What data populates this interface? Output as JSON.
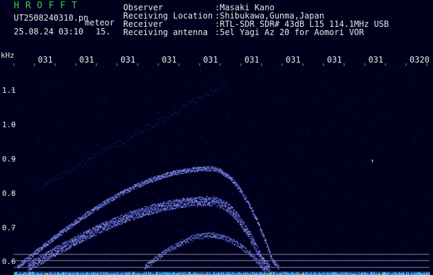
{
  "header": {
    "logo": "HROFFT",
    "filename": "UT2508240310.pn",
    "datetime": "25.08.24 03:10",
    "detection_type": "meteor",
    "count": "15.",
    "fields": [
      {
        "label": "Observer",
        "value": ":Masaki Kano"
      },
      {
        "label": "Receiving Location",
        "value": ":Shibukawa,Gunma,Japan"
      },
      {
        "label": "Receiver",
        "value": ":RTL-SDR SDR# 43dB L15 114.1MHz USB"
      },
      {
        "label": "Receiving antenna",
        "value": ":5el Yagi Az 20 for Aomori VOR"
      }
    ]
  },
  "axis": {
    "unit": "kHz",
    "time_ticks": [
      "031",
      "031",
      "031",
      "031",
      "031",
      "031",
      "031",
      "031",
      "031",
      "0320"
    ],
    "freq_ticks": [
      "1.1",
      "1.0",
      "0.9",
      "0.8",
      "0.7",
      "0.6"
    ]
  },
  "colors": {
    "background": "#00001c",
    "text": "#e8e8e8",
    "logo": "#37d437",
    "echo": "#6a78ff",
    "baseline_noise": "#3fd7ff"
  }
}
